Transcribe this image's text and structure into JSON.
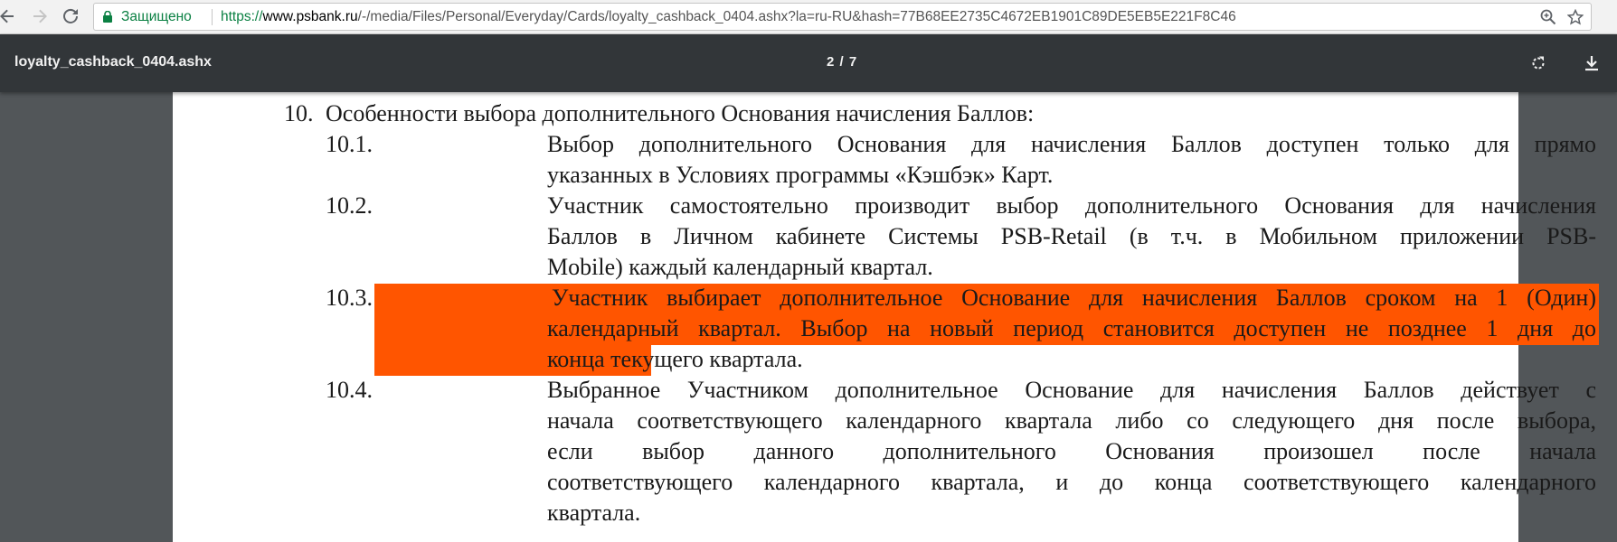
{
  "browser": {
    "secure_label": "Защищено",
    "url_scheme": "https://",
    "url_host": "www.psbank.ru",
    "url_path": "/-/media/Files/Personal/Everyday/Cards/loyalty_cashback_0404.ashx?la=ru-RU&hash=77B68EE2735C4672EB1901C89DE5EB5E221F8C46",
    "icons": [
      "back-icon",
      "forward-icon",
      "reload-icon",
      "lock-icon",
      "zoom-icon",
      "bookmark-star-icon"
    ]
  },
  "viewer": {
    "title": "loyalty_cashback_0404.ashx",
    "page_indicator": "2 / 7",
    "icons": [
      "rotate-icon",
      "download-icon"
    ]
  },
  "document": {
    "section": {
      "number": "10.",
      "text": "Особенности выбора дополнительного Основания начисления Баллов:"
    },
    "items": [
      {
        "number": "10.1.",
        "lines": [
          "Выбор дополнительного Основания для начисления Баллов доступен только для прямо",
          "указанных в Условиях программы «Кэшбэк» Карт."
        ]
      },
      {
        "number": "10.2.",
        "lines": [
          "Участник самостоятельно производит выбор дополнительного Основания для начисления",
          "Баллов в Личном кабинете Системы PSB-Retail (в т.ч. в Мобильном приложении PSB-",
          "Mobile) каждый календарный квартал."
        ]
      },
      {
        "number": "10.3.",
        "highlighted": true,
        "highlight_color": "#ff5500",
        "lines": [
          "Участник выбирает дополнительное Основание для начисления Баллов сроком на 1 (Один)",
          "календарный квартал. Выбор на новый период становится доступен не позднее 1 дня до",
          "конца текущего квартала."
        ]
      },
      {
        "number": "10.4.",
        "lines": [
          "Выбранное Участником дополнительное Основание для начисления Баллов действует с",
          "начала соответствующего календарного квартала либо со следующего дня после выбора,",
          "если выбор данного дополнительного Основания произошел после начала",
          "соответствующего календарного квартала, и до конца соответствующего календарного",
          "квартала."
        ]
      }
    ]
  },
  "colors": {
    "chrome_bar": "#f2f2f2",
    "secure_green": "#0b8043",
    "viewer_toolbar": "#323639",
    "viewer_background": "#525659",
    "page": "#ffffff",
    "highlight": "#ff5500"
  }
}
